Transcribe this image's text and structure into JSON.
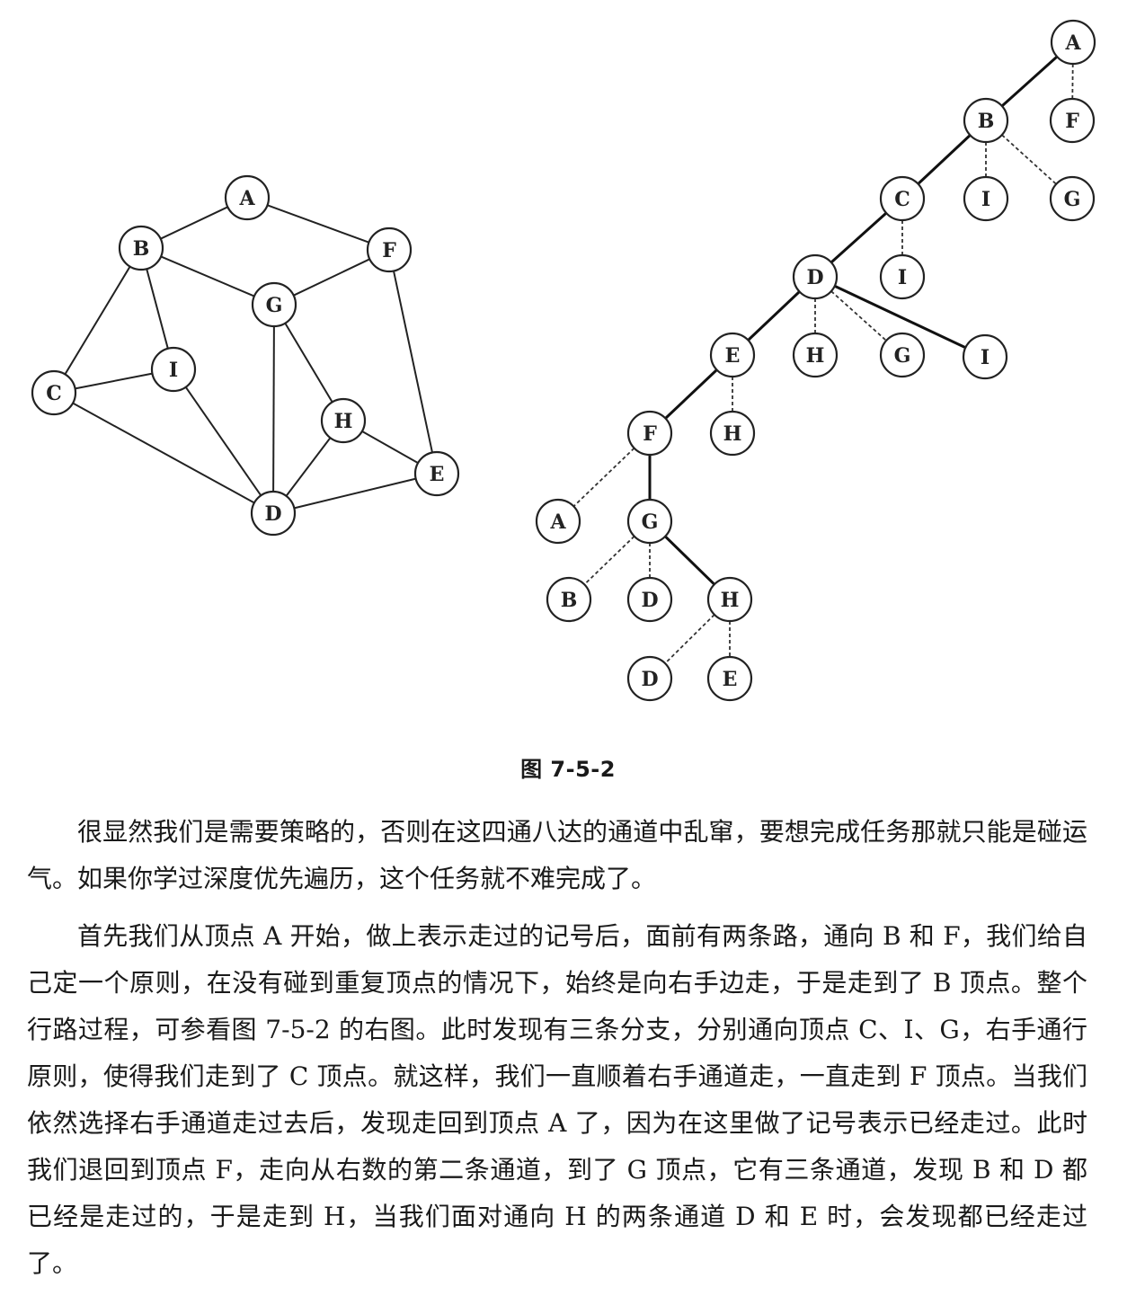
{
  "figure": {
    "caption": "图 7-5-2",
    "graph": {
      "nodes": [
        {
          "id": "A",
          "label": "A"
        },
        {
          "id": "B",
          "label": "B"
        },
        {
          "id": "F",
          "label": "F"
        },
        {
          "id": "G",
          "label": "G"
        },
        {
          "id": "I",
          "label": "I"
        },
        {
          "id": "C",
          "label": "C"
        },
        {
          "id": "H",
          "label": "H"
        },
        {
          "id": "E",
          "label": "E"
        },
        {
          "id": "D",
          "label": "D"
        }
      ],
      "edges": [
        [
          "A",
          "B"
        ],
        [
          "A",
          "F"
        ],
        [
          "B",
          "G"
        ],
        [
          "B",
          "I"
        ],
        [
          "B",
          "C"
        ],
        [
          "F",
          "G"
        ],
        [
          "F",
          "E"
        ],
        [
          "C",
          "I"
        ],
        [
          "C",
          "D"
        ],
        [
          "I",
          "D"
        ],
        [
          "G",
          "D"
        ],
        [
          "G",
          "H"
        ],
        [
          "H",
          "D"
        ],
        [
          "H",
          "E"
        ],
        [
          "D",
          "E"
        ]
      ]
    },
    "tree": {
      "nodes": [
        {
          "id": "A",
          "label": "A"
        },
        {
          "id": "B",
          "label": "B"
        },
        {
          "id": "F1",
          "label": "F"
        },
        {
          "id": "C",
          "label": "C"
        },
        {
          "id": "I1",
          "label": "I"
        },
        {
          "id": "G1",
          "label": "G"
        },
        {
          "id": "D",
          "label": "D"
        },
        {
          "id": "I2",
          "label": "I"
        },
        {
          "id": "E",
          "label": "E"
        },
        {
          "id": "H1",
          "label": "H"
        },
        {
          "id": "G2",
          "label": "G"
        },
        {
          "id": "I3",
          "label": "I"
        },
        {
          "id": "F",
          "label": "F"
        },
        {
          "id": "H2",
          "label": "H"
        },
        {
          "id": "A2",
          "label": "A"
        },
        {
          "id": "G",
          "label": "G"
        },
        {
          "id": "B2",
          "label": "B"
        },
        {
          "id": "D2",
          "label": "D"
        },
        {
          "id": "H",
          "label": "H"
        },
        {
          "id": "D3",
          "label": "D"
        },
        {
          "id": "E2",
          "label": "E"
        }
      ],
      "tree_edges": [
        [
          "A",
          "B"
        ],
        [
          "B",
          "C"
        ],
        [
          "C",
          "D"
        ],
        [
          "D",
          "E"
        ],
        [
          "D",
          "I3"
        ],
        [
          "E",
          "F"
        ],
        [
          "F",
          "G"
        ],
        [
          "G",
          "H"
        ]
      ],
      "back_edges": [
        [
          "A",
          "F1"
        ],
        [
          "B",
          "I1"
        ],
        [
          "B",
          "G1"
        ],
        [
          "C",
          "I2"
        ],
        [
          "D",
          "H1"
        ],
        [
          "D",
          "G2"
        ],
        [
          "E",
          "H2"
        ],
        [
          "F",
          "A2"
        ],
        [
          "G",
          "B2"
        ],
        [
          "G",
          "D2"
        ],
        [
          "H",
          "D3"
        ],
        [
          "H",
          "E2"
        ]
      ]
    }
  },
  "paragraphs": [
    "很显然我们是需要策略的，否则在这四通八达的通道中乱窜，要想完成任务那就只能是碰运气。如果你学过深度优先遍历，这个任务就不难完成了。",
    "首先我们从顶点 A 开始，做上表示走过的记号后，面前有两条路，通向 B 和 F，我们给自己定一个原则，在没有碰到重复顶点的情况下，始终是向右手边走，于是走到了 B 顶点。整个行路过程，可参看图 7-5-2 的右图。此时发现有三条分支，分别通向顶点 C、I、G，右手通行原则，使得我们走到了 C 顶点。就这样，我们一直顺着右手通道走，一直走到 F 顶点。当我们依然选择右手通道走过去后，发现走回到顶点 A 了，因为在这里做了记号表示已经走过。此时我们退回到顶点 F，走向从右数的第二条通道，到了 G 顶点，它有三条通道，发现 B 和 D 都已经是走过的，于是走到 H，当我们面对通向 H 的两条通道 D 和 E 时，会发现都已经走过了。"
  ]
}
